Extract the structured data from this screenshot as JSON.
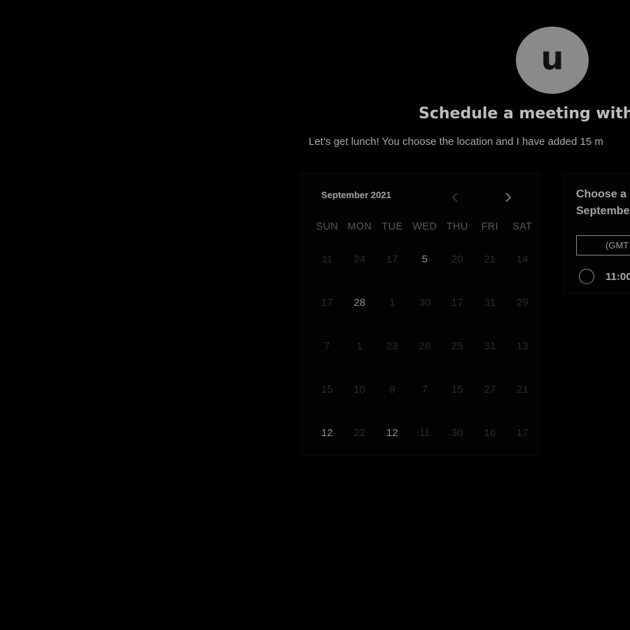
{
  "avatar": {
    "initial": "u"
  },
  "header": {
    "title": "Schedule a meeting with",
    "subtitle": "Let’s get lunch! You choose the location and I have added 15 m"
  },
  "calendar": {
    "month_label": "September 2021",
    "prev_icon": "chevron-left-icon",
    "next_icon": "chevron-right-icon",
    "weekdays": [
      "SUN",
      "MON",
      "TUE",
      "WED",
      "THU",
      "FRI",
      "SAT"
    ],
    "weeks": [
      [
        "11",
        "24",
        "17",
        "5",
        "20",
        "21",
        "14"
      ],
      [
        "17",
        "28",
        "1",
        "30",
        "17",
        "31",
        "29"
      ],
      [
        "7",
        "1",
        "23",
        "26",
        "25",
        "31",
        "13"
      ],
      [
        "15",
        "10",
        "9",
        "7",
        "15",
        "27",
        "21"
      ],
      [
        "12",
        "22",
        "12",
        "11",
        "30",
        "16",
        "17"
      ]
    ]
  },
  "time_picker": {
    "heading_line1": "Choose a",
    "heading_line2": "Septembe",
    "timezone_value": "(GMT",
    "slots": [
      "11:00"
    ]
  },
  "colors": {
    "background": "#000000",
    "avatar": "#8a8a8a",
    "text_primary": "#bdbdbd"
  }
}
